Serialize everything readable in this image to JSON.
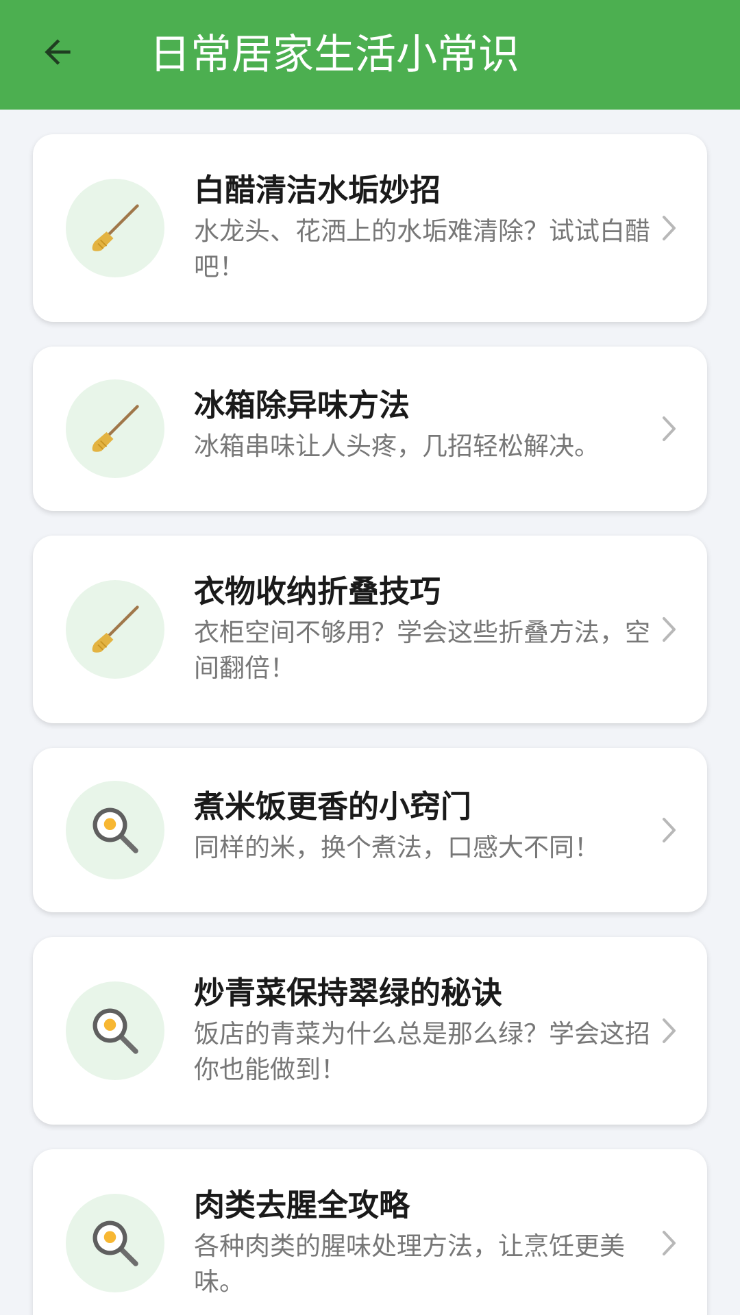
{
  "header": {
    "title": "日常居家生活小常识",
    "back_icon": "arrow-left-icon"
  },
  "colors": {
    "primary": "#4caf50",
    "icon_bg": "#e8f5e9",
    "background": "#f2f4f8"
  },
  "items": [
    {
      "title": "白醋清洁水垢妙招",
      "desc": "水龙头、花洒上的水垢难清除？试试白醋吧！",
      "icon": "broom-icon"
    },
    {
      "title": "冰箱除异味方法",
      "desc": "冰箱串味让人头疼，几招轻松解决。",
      "icon": "broom-icon"
    },
    {
      "title": "衣物收纳折叠技巧",
      "desc": "衣柜空间不够用？学会这些折叠方法，空间翻倍！",
      "icon": "broom-icon"
    },
    {
      "title": "煮米饭更香的小窍门",
      "desc": "同样的米，换个煮法，口感大不同！",
      "icon": "frying-pan-egg-icon"
    },
    {
      "title": "炒青菜保持翠绿的秘诀",
      "desc": "饭店的青菜为什么总是那么绿？学会这招你也能做到！",
      "icon": "frying-pan-egg-icon"
    },
    {
      "title": "肉类去腥全攻略",
      "desc": "各种肉类的腥味处理方法，让烹饪更美味。",
      "icon": "frying-pan-egg-icon"
    }
  ]
}
